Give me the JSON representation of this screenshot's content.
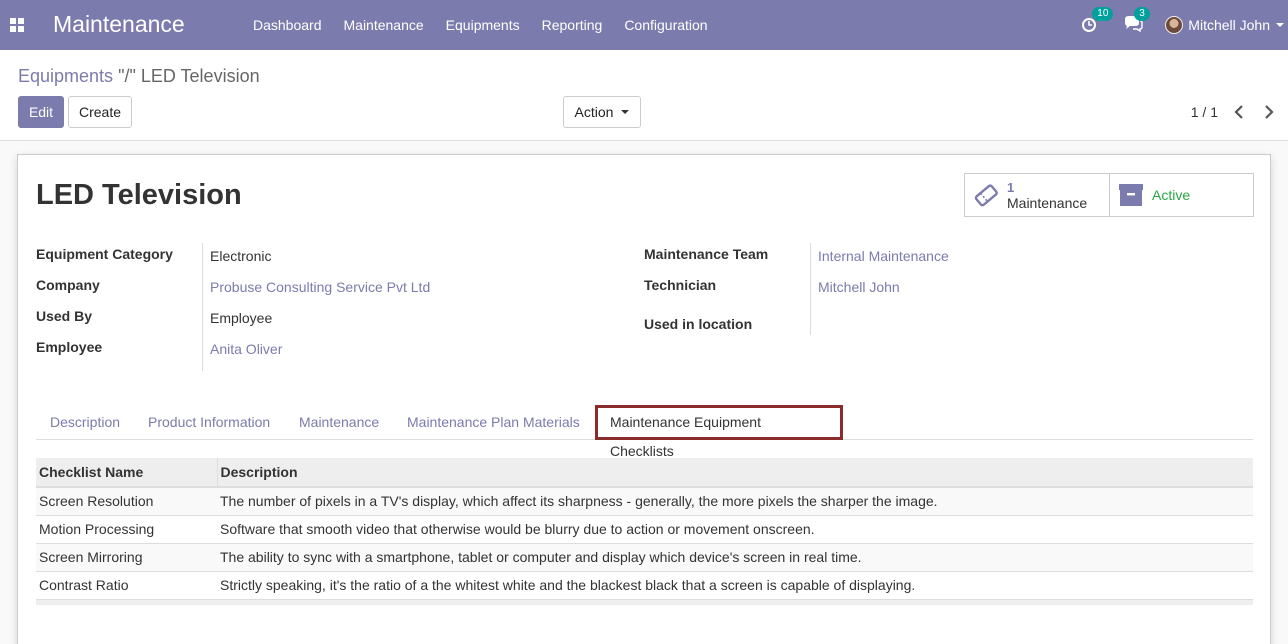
{
  "navbar": {
    "brand": "Maintenance",
    "menu": [
      "Dashboard",
      "Maintenance",
      "Equipments",
      "Reporting",
      "Configuration"
    ],
    "activity_badge": "10",
    "messages_badge": "3",
    "user_name": "Mitchell John"
  },
  "control_panel": {
    "breadcrumb_parent": "Equipments",
    "breadcrumb_current": "\"/\" LED Television",
    "edit_label": "Edit",
    "create_label": "Create",
    "action_label": "Action",
    "pager": "1 / 1"
  },
  "form": {
    "title": "LED Television",
    "smart_buttons": {
      "maintenance_count": "1",
      "maintenance_label": "Maintenance",
      "active_label": "Active"
    },
    "left_fields": [
      {
        "label": "Equipment Category",
        "value": "Electronic"
      },
      {
        "label": "Company",
        "value": "Probuse Consulting Service Pvt Ltd"
      },
      {
        "label": "Used By",
        "value": "Employee"
      },
      {
        "label": "Employee",
        "value": "Anita Oliver"
      }
    ],
    "right_fields": [
      {
        "label": "Maintenance Team",
        "value": "Internal Maintenance"
      },
      {
        "label": "Technician",
        "value": "Mitchell John"
      },
      {
        "label": "Used in location",
        "value": ""
      }
    ],
    "tabs": [
      "Description",
      "Product Information",
      "Maintenance",
      "Maintenance Plan Materials",
      "Maintenance Equipment Checklists"
    ],
    "table": {
      "headers": [
        "Checklist Name",
        "Description"
      ],
      "rows": [
        [
          "Screen Resolution",
          "The number of pixels in a TV's display, which affect its sharpness - generally, the more pixels the sharper the image."
        ],
        [
          "Motion Processing",
          "Software that smooth video that otherwise would be blurry due to action or movement onscreen."
        ],
        [
          "Screen Mirroring",
          "The ability to sync with a smartphone, tablet or computer and display which device's screen in real time."
        ],
        [
          "Contrast Ratio",
          "Strictly speaking, it's the ratio of a the whitest white and the blackest black that a screen is capable of displaying."
        ]
      ]
    }
  },
  "colors": {
    "primary": "#7c7bad",
    "badge": "#00a09d",
    "active": "#28a745",
    "highlight_border": "#8b2c2c"
  }
}
